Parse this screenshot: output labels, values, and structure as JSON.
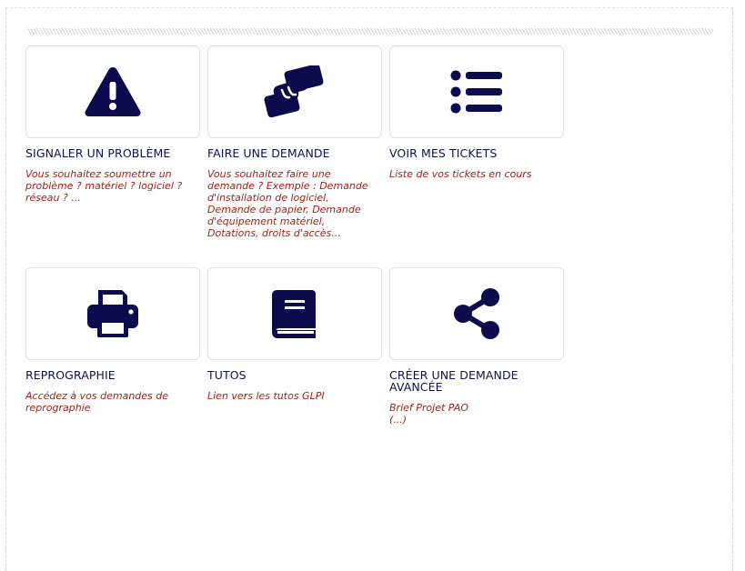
{
  "tiles": [
    {
      "title": "SIGNALER UN PROBLÈME",
      "icon": "warning-triangle-icon",
      "description": "Vous souhaitez soumettre un problème ? matériel ? logiciel ? réseau ? ..."
    },
    {
      "title": "FAIRE UNE DEMANDE",
      "icon": "handshake-icon",
      "description": "Vous souhaitez faire une demande ? Exemple : Demande d'installation de logiciel, Demande de papier, Demande d'équipement matériel, Dotations, droits d'accès..."
    },
    {
      "title": "VOIR MES TICKETS",
      "icon": "list-icon",
      "description": "Liste de vos tickets en cours"
    },
    {
      "title": "REPROGRAPHIE",
      "icon": "printer-icon",
      "description": "Accédez à vos demandes de reprographie"
    },
    {
      "title": "TUTOS",
      "icon": "book-icon",
      "description": "Lien vers les tutos GLPI"
    },
    {
      "title": "CRÉER UNE DEMANDE AVANCÉE",
      "icon": "share-icon",
      "description": "Brief Projet PAO\n(...)"
    }
  ],
  "colors": {
    "icon": "#0b0b4e",
    "title": "#11114a",
    "description": "#a0231a",
    "border": "#e1e1e1"
  }
}
